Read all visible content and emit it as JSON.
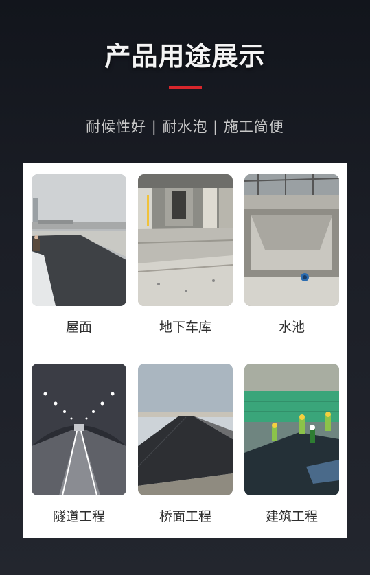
{
  "header": {
    "title": "产品用途展示",
    "subtitle": "耐候性好 | 耐水泡 | 施工简便",
    "accent_color": "#d8262c"
  },
  "gallery": {
    "items": [
      {
        "caption": "屋面",
        "scene": "rooftop-membrane"
      },
      {
        "caption": "地下车库",
        "scene": "underground-garage"
      },
      {
        "caption": "水池",
        "scene": "concrete-pool"
      },
      {
        "caption": "隧道工程",
        "scene": "tunnel"
      },
      {
        "caption": "桥面工程",
        "scene": "bridge-deck"
      },
      {
        "caption": "建筑工程",
        "scene": "construction-site"
      }
    ]
  }
}
